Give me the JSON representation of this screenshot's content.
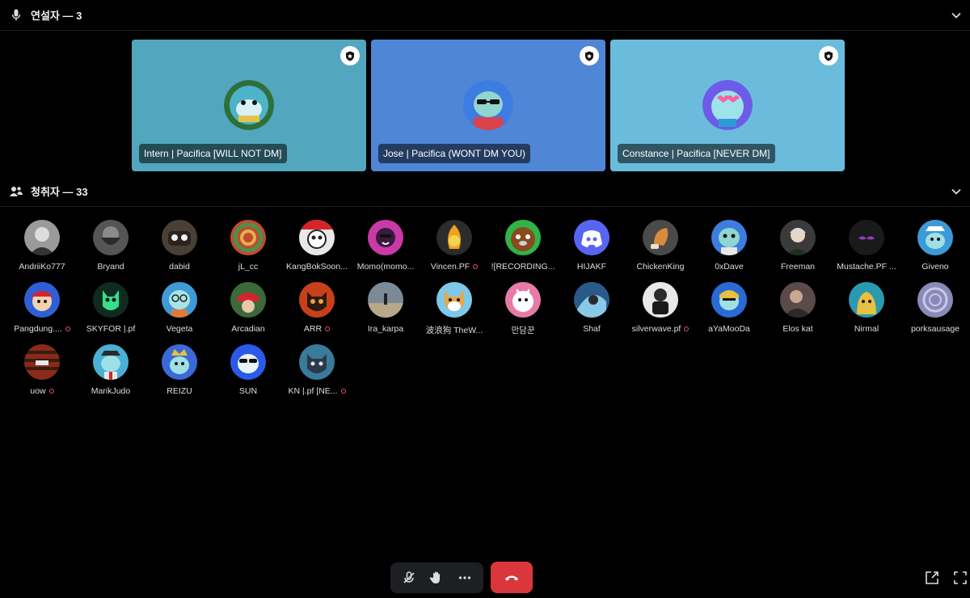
{
  "speakers_section": {
    "title": "연설자 — 3",
    "icon": "microphone-icon"
  },
  "audience_section": {
    "title": "청취자 — 33",
    "icon": "audience-icon"
  },
  "colors": {
    "card1": "#52a6bd",
    "card2": "#4f86d6",
    "card3": "#6bbbdc",
    "leave": "#da373c",
    "nitro_dot": "#eb459e"
  },
  "speakers": [
    {
      "name": "Intern | Pacifica [WILL NOT DM]"
    },
    {
      "name": "Jose | Pacifica (WONT DM YOU)"
    },
    {
      "name": "Constance | Pacifica [NEVER DM]"
    }
  ],
  "audience": [
    {
      "name": "AndriiKo777"
    },
    {
      "name": "Bryand"
    },
    {
      "name": "dabid"
    },
    {
      "name": "jL_cc"
    },
    {
      "name": "KangBokSoon..."
    },
    {
      "name": "Momo(momo..."
    },
    {
      "name": "Vincen.PF"
    },
    {
      "name": "![RECORDING..."
    },
    {
      "name": "HIJAKF"
    },
    {
      "name": "ChickenKing"
    },
    {
      "name": "0xDave"
    },
    {
      "name": "Freeman"
    },
    {
      "name": "Mustache.PF ..."
    },
    {
      "name": "Giveno"
    },
    {
      "name": "Pangdung...."
    },
    {
      "name": "SKYFOR |.pf"
    },
    {
      "name": "Vegeta"
    },
    {
      "name": "Arcadian"
    },
    {
      "name": "ARR"
    },
    {
      "name": "Ira_karpa"
    },
    {
      "name": "波浪狗 TheW..."
    },
    {
      "name": "만담꾼"
    },
    {
      "name": "Shaf"
    },
    {
      "name": "silverwave.pf"
    },
    {
      "name": "aYaMooDa"
    },
    {
      "name": "Elos kat"
    },
    {
      "name": "Nirmal"
    },
    {
      "name": "porksausage"
    },
    {
      "name": "uow"
    },
    {
      "name": "MarikJudo"
    },
    {
      "name": "REIZU"
    },
    {
      "name": "SUN"
    },
    {
      "name": "KN |.pf [NE..."
    }
  ]
}
